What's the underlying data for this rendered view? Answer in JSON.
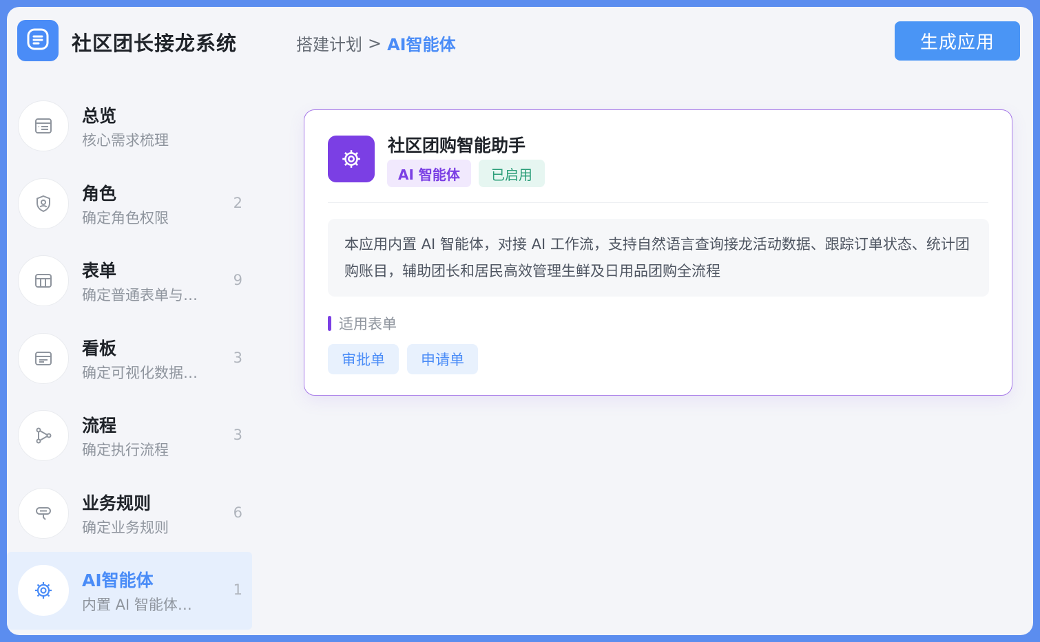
{
  "app": {
    "title": "社区团长接龙系统",
    "logo_icon": "document-list-icon"
  },
  "breadcrumb": {
    "parent": "搭建计划",
    "separator": ">",
    "current": "AI智能体"
  },
  "header": {
    "generate_label": "生成应用"
  },
  "colors": {
    "accent": "#4a8cf7",
    "agent_purple": "#7b3fe4",
    "enabled_green": "#2a9d78"
  },
  "sidebar": {
    "items": [
      {
        "title": "总览",
        "subtitle": "核心需求梳理",
        "count": "",
        "icon": "overview-icon"
      },
      {
        "title": "角色",
        "subtitle": "确定角色权限",
        "count": "2",
        "icon": "shield-user-icon"
      },
      {
        "title": "表单",
        "subtitle": "确定普通表单与…",
        "count": "9",
        "icon": "table-icon"
      },
      {
        "title": "看板",
        "subtitle": "确定可视化数据…",
        "count": "3",
        "icon": "dashboard-icon"
      },
      {
        "title": "流程",
        "subtitle": "确定执行流程",
        "count": "3",
        "icon": "flow-icon"
      },
      {
        "title": "业务规则",
        "subtitle": "确定业务规则",
        "count": "6",
        "icon": "rule-icon"
      },
      {
        "title": "AI智能体",
        "subtitle": "内置 AI 智能体…",
        "count": "1",
        "icon": "ai-gear-icon",
        "active": true
      }
    ]
  },
  "agent": {
    "name": "社区团购智能助手",
    "icon": "ai-gear-icon",
    "tags": {
      "type": "AI 智能体",
      "status": "已启用"
    },
    "description": "本应用内置 AI 智能体，对接 AI 工作流，支持自然语言查询接龙活动数据、跟踪订单状态、统计团购账目，辅助团长和居民高效管理生鲜及日用品团购全流程",
    "forms_label": "适用表单",
    "forms": [
      "审批单",
      "申请单"
    ]
  }
}
